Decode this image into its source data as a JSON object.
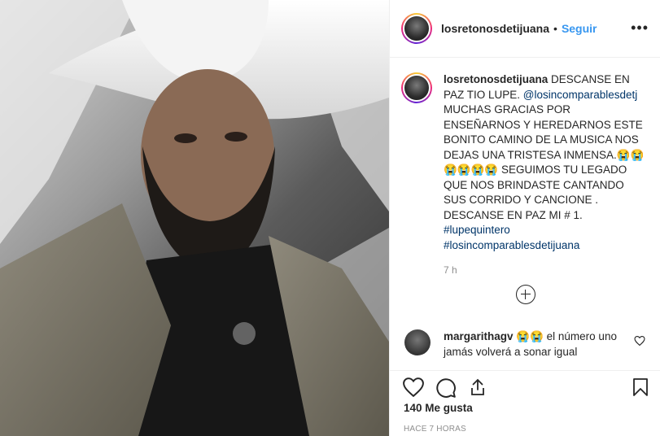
{
  "post": {
    "username": "losretonosdetijuana",
    "follow_label": "Seguir",
    "separator": "•",
    "more_label": "•••"
  },
  "caption": {
    "username": "losretonosdetijuana",
    "text_1": " DESCANSE EN PAZ TIO LUPE. ",
    "mention": "@losincomparablesdetj",
    "text_2": " MUCHAS GRACIAS POR ENSEÑARNOS Y HEREDARNOS ESTE BONITO CAMINO DE LA MUSICA NOS DEJAS UNA TRISTESA INMENSA.😭😭😭😭😭😭 SEGUIMOS TU LEGADO QUE NOS BRINDASTE CANTANDO SUS CORRIDO Y CANCIONE .",
    "text_3": "DESCANSE EN PAZ MI # 1.",
    "hashtag_1": "#lupequintero",
    "hashtag_2": "#losincomparablesdetijuana",
    "time": "7 h"
  },
  "comment": {
    "username": "margarithagv",
    "text": " 😭😭 el número uno jamás volverá a sonar igual"
  },
  "footer": {
    "likes": "140 Me gusta",
    "posted_ago": "HACE 7 HORAS"
  }
}
